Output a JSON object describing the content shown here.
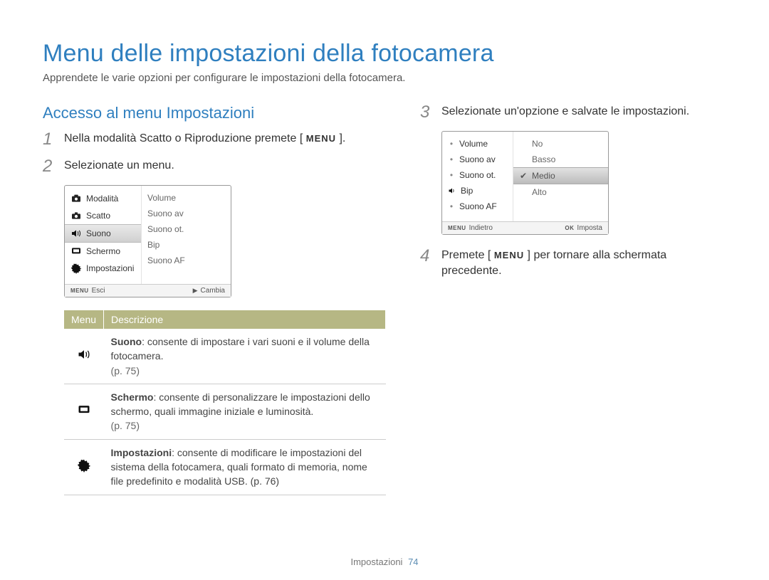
{
  "page_title": "Menu delle impostazioni della fotocamera",
  "lead": "Apprendete le varie opzioni per configurare le impostazioni della fotocamera.",
  "section_title": "Accesso al menu Impostazioni",
  "steps": {
    "s1_pre": "Nella modalità Scatto o Riproduzione premete [",
    "s1_menu": "MENU",
    "s1_post": "].",
    "s2": "Selezionate un menu.",
    "s3": "Selezionate un'opzione e salvate le impostazioni.",
    "s4_pre": "Premete [",
    "s4_menu": "MENU",
    "s4_post": "] per tornare alla schermata precedente."
  },
  "shot_a": {
    "left": {
      "modalita": "Modalità",
      "scatto": "Scatto",
      "suono": "Suono",
      "schermo": "Schermo",
      "impostazioni": "Impostazioni"
    },
    "right": {
      "volume": "Volume",
      "suono_av": "Suono av",
      "suono_ot": "Suono ot.",
      "bip": "Bip",
      "suono_af": "Suono AF"
    },
    "footer": {
      "menu": "MENU",
      "esci": "Esci",
      "cambia": "Cambia"
    }
  },
  "shot_b": {
    "left": {
      "volume": "Volume",
      "suono_av": "Suono av",
      "suono_ot": "Suono ot.",
      "bip": "Bip",
      "suono_af": "Suono AF"
    },
    "right": {
      "no": "No",
      "basso": "Basso",
      "medio": "Medio",
      "alto": "Alto"
    },
    "footer": {
      "menu": "MENU",
      "indietro": "Indietro",
      "ok": "OK",
      "imposta": "Imposta"
    }
  },
  "table": {
    "head_menu": "Menu",
    "head_desc": "Descrizione",
    "row_suono_term": "Suono",
    "row_suono_text": ": consente di impostare i vari suoni e il volume della fotocamera.",
    "row_suono_page": "(p. 75)",
    "row_schermo_term": "Schermo",
    "row_schermo_text": ": consente di personalizzare le impostazioni dello schermo, quali immagine iniziale e luminosità.",
    "row_schermo_page": "(p. 75)",
    "row_imp_term": "Impostazioni",
    "row_imp_text": ": consente di modificare le impostazioni del sistema della fotocamera, quali formato di memoria, nome file predefinito e modalità USB. (p. 76)"
  },
  "footer": {
    "section": "Impostazioni",
    "page": "74"
  }
}
